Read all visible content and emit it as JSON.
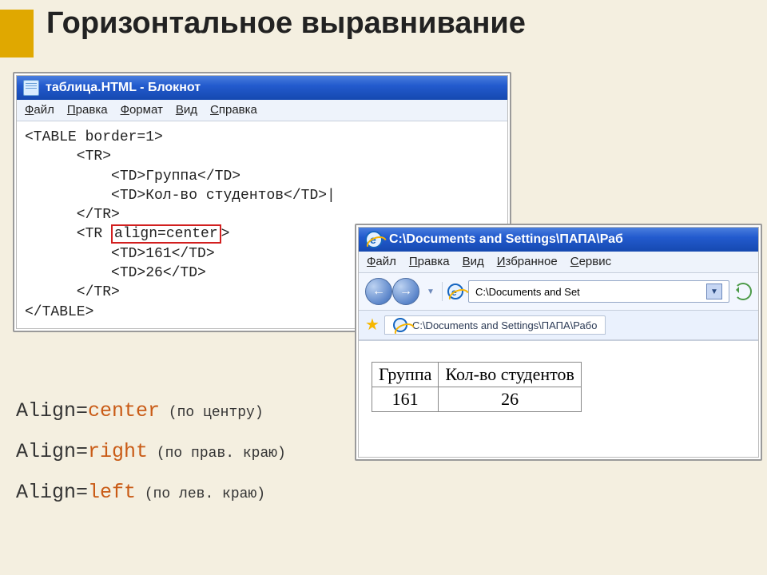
{
  "title": "Горизонтальное выравнивание",
  "notepad": {
    "window_title": "таблица.HTML - Блокнот",
    "menu": [
      "Файл",
      "Правка",
      "Формат",
      "Вид",
      "Справка"
    ],
    "code": {
      "l1": "<TABLE border=1>",
      "l2": "      <TR>",
      "l3": "          <TD>Группа</TD>",
      "l4": "          <TD>Кол-во студентов</TD>|",
      "l5": "      </TR>",
      "l6a": "      <TR ",
      "l6_hl": "align=center",
      "l6b": ">",
      "l7": "          <TD>161</TD>",
      "l8": "          <TD>26</TD>",
      "l9": "      </TR>",
      "l10": "</TABLE>"
    }
  },
  "legend": {
    "r1a": "Align=",
    "r1b": "center",
    "r1c": " (по центру)",
    "r2a": "Align=",
    "r2b": "right",
    "r2c": " (по прав. краю)",
    "r3a": "Align=",
    "r3b": "left",
    "r3c": " (по лев. краю)"
  },
  "ie": {
    "window_title": "C:\\Documents and Settings\\ПАПА\\Раб",
    "menu": [
      "Файл",
      "Правка",
      "Вид",
      "Избранное",
      "Сервис"
    ],
    "address": "C:\\Documents and Set",
    "tab_text": "C:\\Documents and Settings\\ПАПА\\Рабо",
    "table": {
      "h1": "Группа",
      "h2": "Кол-во студентов",
      "c1": "161",
      "c2": "26"
    }
  }
}
